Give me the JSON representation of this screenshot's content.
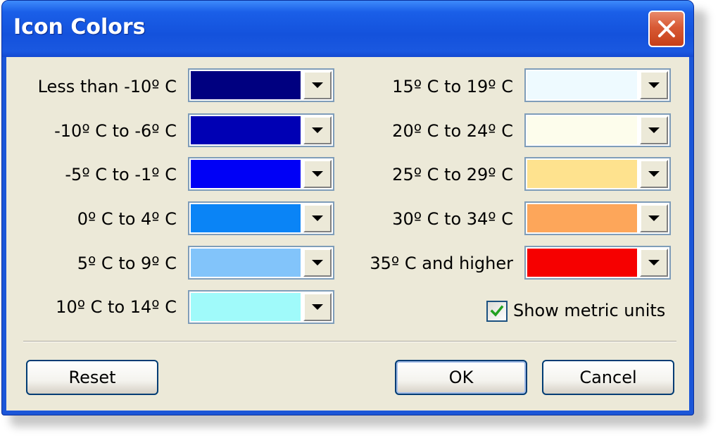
{
  "window": {
    "title": "Icon Colors"
  },
  "left_rows": [
    {
      "label": "Less than -10º C",
      "color": "#000080"
    },
    {
      "label": "-10º C to -6º C",
      "color": "#0000b4"
    },
    {
      "label": "-5º C to -1º C",
      "color": "#0000f6"
    },
    {
      "label": "0º C to 4º C",
      "color": "#0a84f6"
    },
    {
      "label": "5º C to 9º C",
      "color": "#82c4fa"
    },
    {
      "label": "10º C to 14º C",
      "color": "#a0fafa"
    }
  ],
  "right_rows": [
    {
      "label": "15º C to 19º C",
      "color": "#eefaff"
    },
    {
      "label": "20º C to 24º C",
      "color": "#fdfdec"
    },
    {
      "label": "25º C to 29º C",
      "color": "#fee28e"
    },
    {
      "label": "30º C to 34º C",
      "color": "#fda65a"
    },
    {
      "label": "35º C and higher",
      "color": "#f60000"
    }
  ],
  "checkbox": {
    "label": "Show metric units",
    "checked": true
  },
  "buttons": {
    "reset": "Reset",
    "ok": "OK",
    "cancel": "Cancel"
  },
  "icons": {
    "close": "close-icon",
    "dropdown": "chevron-down-icon",
    "check": "checkmark-icon"
  },
  "colors": {
    "titlebar": "#1452dc",
    "client_bg": "#ece9d8",
    "close_button": "#d85a35"
  }
}
